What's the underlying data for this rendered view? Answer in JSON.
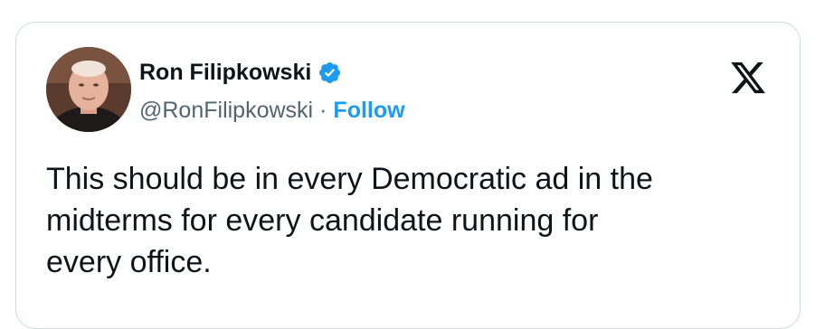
{
  "tweet": {
    "author": {
      "display_name": "Ron Filipkowski",
      "handle": "@RonFilipkowski",
      "verified": true,
      "verified_icon": "verified-badge-icon",
      "avatar": "avatar-photo"
    },
    "separator": "·",
    "follow_label": "Follow",
    "platform_icon": "x-logo-icon",
    "text": "This should be in every Democratic ad in the\nmidterms for every candidate running for\nevery office."
  },
  "colors": {
    "link": "#1d9bf0",
    "text": "#0f1419",
    "secondary": "#536471",
    "border": "#cfd9de",
    "verified": "#1d9bf0"
  }
}
